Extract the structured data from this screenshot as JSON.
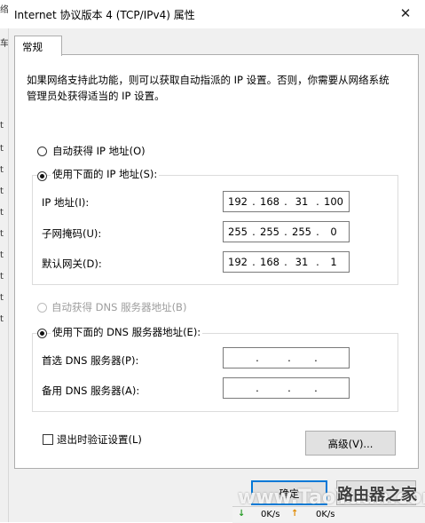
{
  "window": {
    "title": "Internet 协议版本 4 (TCP/IPv4) 属性",
    "close_glyph": "✕"
  },
  "left_strip": [
    "络",
    "车",
    "t",
    "t",
    "t",
    "t",
    "t",
    "t",
    "t",
    "t",
    "t",
    "t"
  ],
  "tab": {
    "label": "常规"
  },
  "description": "如果网络支持此功能，则可以获取自动指派的 IP 设置。否则，你需要从网络系统管理员处获得适当的 IP 设置。",
  "ip_section": {
    "auto_label": "自动获得 IP 地址(O)",
    "manual_label": "使用下面的 IP 地址(S):",
    "selected": "manual",
    "fields": [
      {
        "label": "IP 地址(I):",
        "octets": [
          "192",
          "168",
          "31",
          "100"
        ]
      },
      {
        "label": "子网掩码(U):",
        "octets": [
          "255",
          "255",
          "255",
          "0"
        ]
      },
      {
        "label": "默认网关(D):",
        "octets": [
          "192",
          "168",
          "31",
          "1"
        ]
      }
    ]
  },
  "dns_section": {
    "auto_label": "自动获得 DNS 服务器地址(B)",
    "auto_disabled": true,
    "manual_label": "使用下面的 DNS 服务器地址(E):",
    "selected": "manual",
    "fields": [
      {
        "label": "首选 DNS 服务器(P):",
        "octets": [
          "",
          "",
          "",
          ""
        ]
      },
      {
        "label": "备用 DNS 服务器(A):",
        "octets": [
          "",
          "",
          "",
          ""
        ]
      }
    ]
  },
  "validate_label": "退出时验证设置(L)",
  "validate_checked": false,
  "advanced_label": "高级(V)...",
  "ok_label": "确定",
  "statusbar": {
    "down_arrow": "↓",
    "down_rate": "0K/s",
    "up_arrow": "↑",
    "up_rate": "0K/s"
  },
  "watermark": {
    "site": "www.TaoYuan.com",
    "name": "路由器之家"
  },
  "colors": {
    "focus_blue": "#0078d7",
    "dialog_bg": "#f0f0f0",
    "down_green": "#2a9d2a",
    "up_orange": "#e08a00"
  }
}
